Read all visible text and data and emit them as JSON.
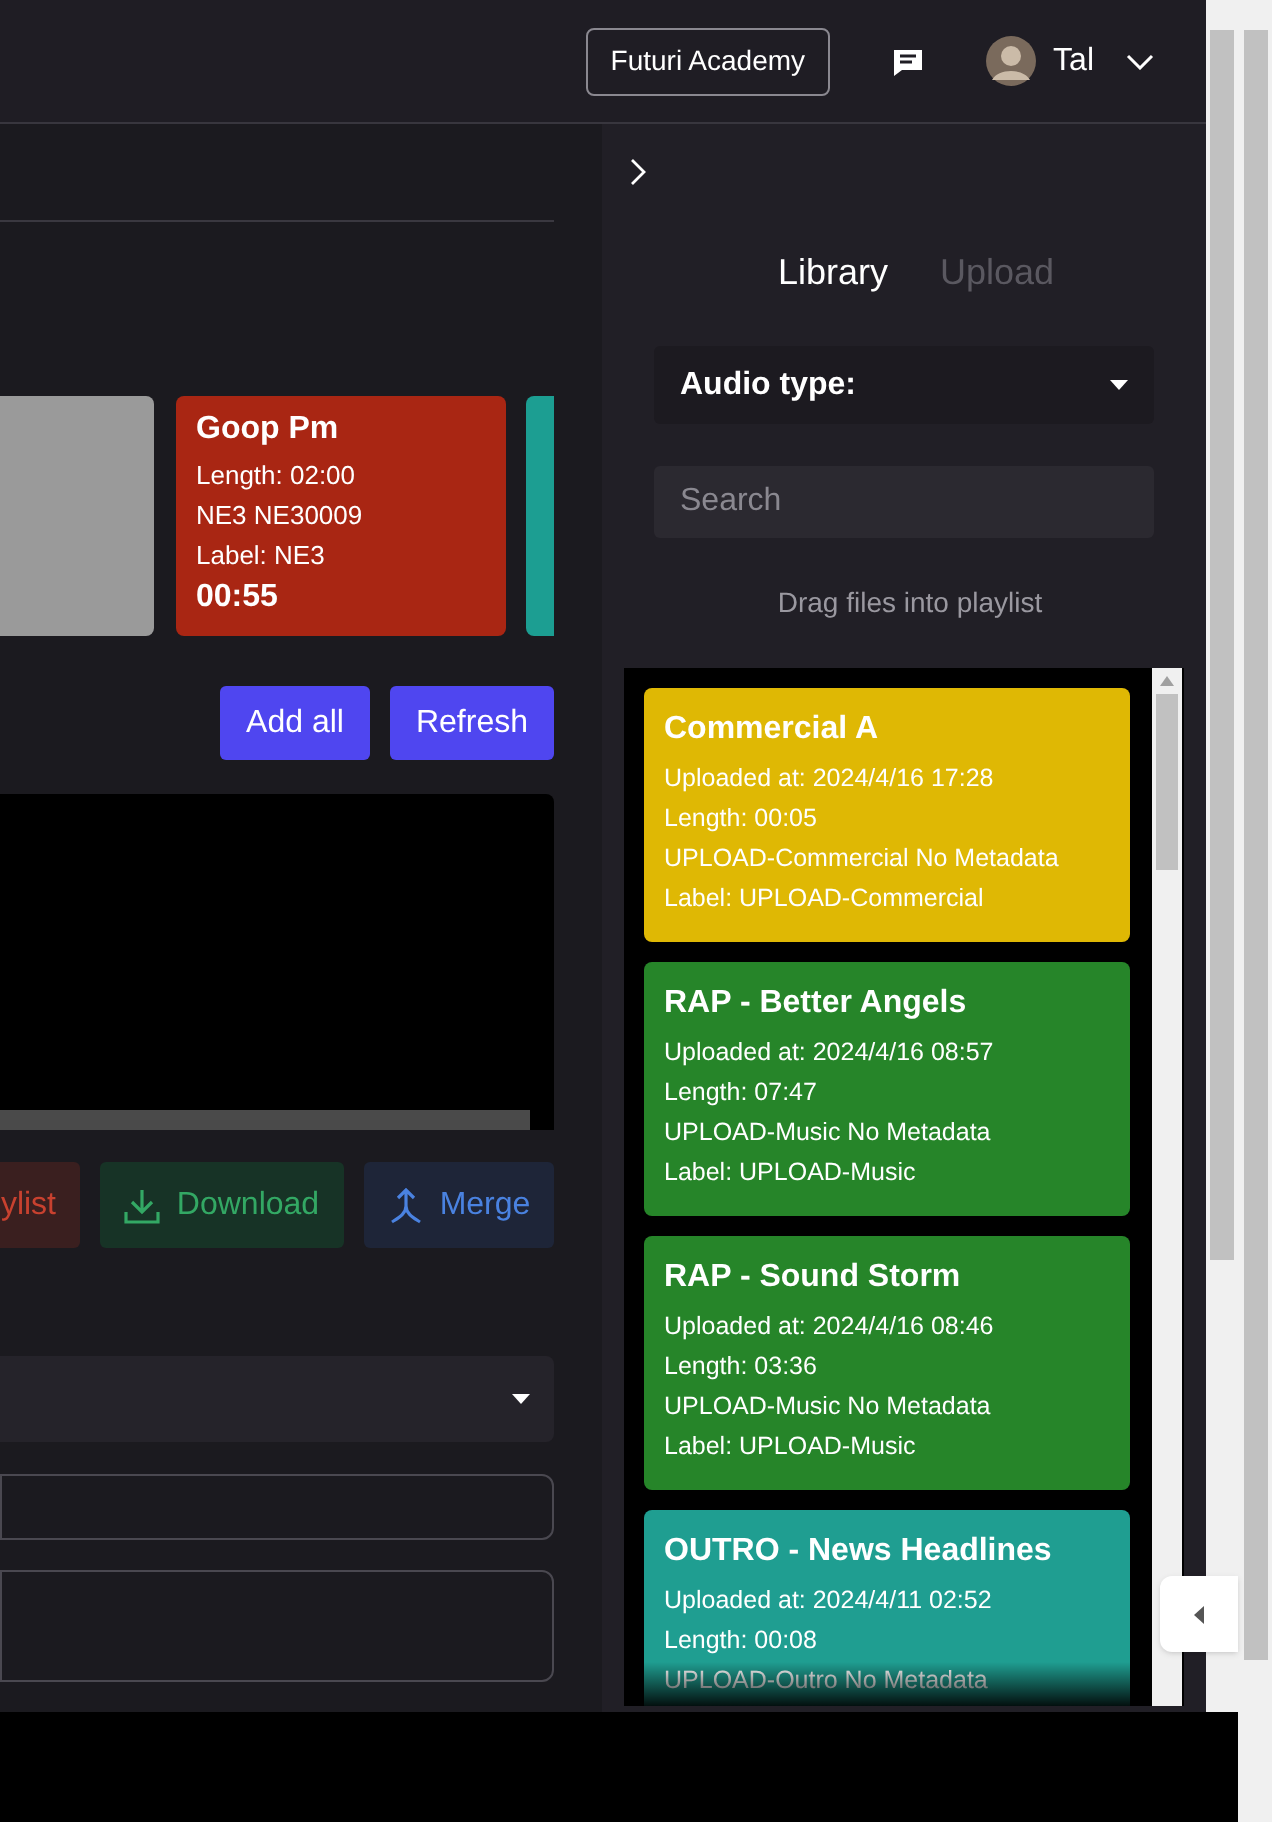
{
  "header": {
    "org_button": "Futuri Academy",
    "user_name": "Tal"
  },
  "playlist_cards": [
    {
      "kind": "blank",
      "color": "#9a9a9a"
    },
    {
      "kind": "full",
      "title": "Goop Pm",
      "lines": [
        "Length: 02:00",
        "NE3 NE30009",
        "Label: NE3"
      ],
      "time": "00:55",
      "color": "#a92613"
    },
    {
      "kind": "blank",
      "color": "#1c9e92"
    }
  ],
  "list_buttons": [
    "Add all",
    "Refresh"
  ],
  "action_buttons": [
    {
      "kind": "playlist",
      "label": "ylist"
    },
    {
      "kind": "download",
      "label": "Download"
    },
    {
      "kind": "merge",
      "label": "Merge"
    }
  ],
  "library": {
    "tabs": [
      {
        "label": "Library",
        "selected": true
      },
      {
        "label": "Upload",
        "selected": false
      }
    ],
    "audio_type": "Audio type:",
    "search_placeholder": "Search",
    "hint": "Drag files into playlist",
    "items": [
      {
        "title": "Commercial A",
        "lines": [
          "Uploaded at: 2024/4/16 17:28",
          "Length: 00:05",
          "UPLOAD-Commercial No Metadata",
          "Label: UPLOAD-Commercial"
        ],
        "color": "#dfb804"
      },
      {
        "title": "RAP - Better Angels",
        "lines": [
          "Uploaded at: 2024/4/16 08:57",
          "Length: 07:47",
          "UPLOAD-Music No Metadata",
          "Label: UPLOAD-Music"
        ],
        "color": "#268529"
      },
      {
        "title": "RAP - Sound Storm",
        "lines": [
          "Uploaded at: 2024/4/16 08:46",
          "Length: 03:36",
          "UPLOAD-Music No Metadata",
          "Label: UPLOAD-Music"
        ],
        "color": "#268529"
      },
      {
        "title": "OUTRO - News Headlines",
        "lines": [
          "Uploaded at: 2024/4/11 02:52",
          "Length: 00:08",
          "UPLOAD-Outro No Metadata"
        ],
        "color": "#1f9e91"
      }
    ]
  }
}
